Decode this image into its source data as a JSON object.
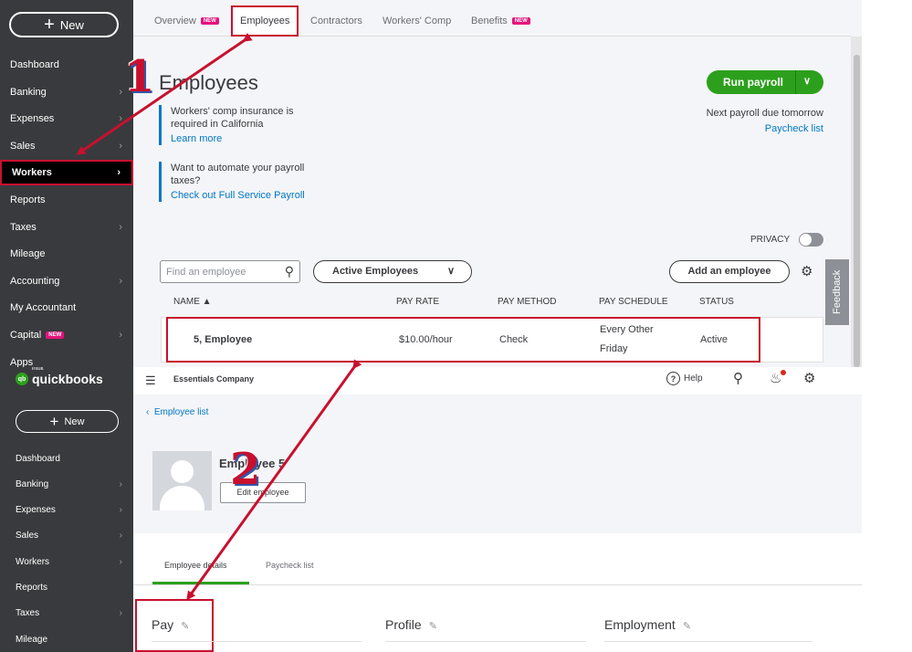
{
  "top": {
    "sidebar": {
      "new_label": "New",
      "items": [
        {
          "label": "Dashboard",
          "chev": false
        },
        {
          "label": "Banking",
          "chev": true
        },
        {
          "label": "Expenses",
          "chev": true
        },
        {
          "label": "Sales",
          "chev": true
        },
        {
          "label": "Workers",
          "chev": true,
          "active": true
        },
        {
          "label": "Reports",
          "chev": false
        },
        {
          "label": "Taxes",
          "chev": true
        },
        {
          "label": "Mileage",
          "chev": false
        },
        {
          "label": "Accounting",
          "chev": true
        },
        {
          "label": "My Accountant",
          "chev": false
        },
        {
          "label": "Capital",
          "chev": true,
          "badge": "NEW"
        },
        {
          "label": "Apps",
          "chev": false
        }
      ]
    },
    "tabs": {
      "overview": "Overview",
      "overview_badge": "NEW",
      "employees": "Employees",
      "contractors": "Contractors",
      "workers_comp": "Workers' Comp",
      "benefits": "Benefits",
      "benefits_badge": "NEW"
    },
    "page_title": "Employees",
    "notice1": {
      "text": "Workers' comp insurance is required in California",
      "link": "Learn more"
    },
    "notice2": {
      "text": "Want to automate your payroll taxes?",
      "link": "Check out Full Service Payroll"
    },
    "run_payroll": "Run payroll",
    "next_payroll": "Next payroll due tomorrow",
    "paycheck_list": "Paycheck list",
    "privacy": "PRIVACY",
    "search_placeholder": "Find an employee",
    "filter_value": "Active Employees",
    "add_employee": "Add an employee",
    "feedback": "Feedback",
    "table": {
      "headers": {
        "name": "NAME ▲",
        "pay_rate": "PAY RATE",
        "pay_method": "PAY METHOD",
        "pay_schedule": "PAY SCHEDULE",
        "status": "STATUS"
      },
      "rows": [
        {
          "name": "5, Employee",
          "pay_rate": "$10.00/hour",
          "pay_method": "Check",
          "pay_schedule_1": "Every Other",
          "pay_schedule_2": "Friday",
          "status": "Active"
        }
      ]
    }
  },
  "bottom": {
    "logo_intuit": "intuit",
    "logo_text": "quickbooks",
    "new_label": "New",
    "sidebar_items": [
      {
        "label": "Dashboard",
        "chev": false
      },
      {
        "label": "Banking",
        "chev": true
      },
      {
        "label": "Expenses",
        "chev": true
      },
      {
        "label": "Sales",
        "chev": true
      },
      {
        "label": "Workers",
        "chev": true
      },
      {
        "label": "Reports",
        "chev": false
      },
      {
        "label": "Taxes",
        "chev": true
      },
      {
        "label": "Mileage",
        "chev": false
      }
    ],
    "company": "Essentials Company",
    "help": "Help",
    "back_link": "Employee list",
    "employee_name": "Employee 5",
    "edit_employee": "Edit employee",
    "tabs": {
      "details": "Employee details",
      "paycheck": "Paycheck list"
    },
    "sections": {
      "pay": "Pay",
      "profile": "Profile",
      "employment": "Employment"
    }
  },
  "annotations": {
    "step1": "1",
    "step2": "2",
    "color": "#c8102e"
  }
}
